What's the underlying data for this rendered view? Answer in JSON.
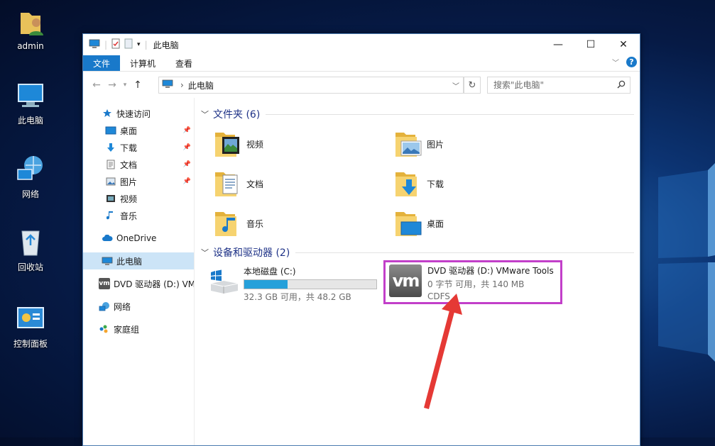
{
  "desktop": {
    "icons": [
      {
        "label": "admin",
        "icon": "user-folder-icon"
      },
      {
        "label": "此电脑",
        "icon": "computer-icon"
      },
      {
        "label": "网络",
        "icon": "network-icon"
      },
      {
        "label": "回收站",
        "icon": "recycle-bin-icon"
      },
      {
        "label": "控制面板",
        "icon": "control-panel-icon"
      }
    ]
  },
  "window": {
    "title": "此电脑",
    "controls": {
      "minimize": "—",
      "maximize": "☐",
      "close": "✕"
    }
  },
  "ribbon": {
    "tabs": [
      "文件",
      "计算机",
      "查看"
    ],
    "help": "?"
  },
  "address": {
    "path": "此电脑",
    "search_placeholder": "搜索\"此电脑\""
  },
  "navpane": {
    "quick_access": "快速访问",
    "quick_items": [
      {
        "label": "桌面",
        "icon": "desktop-icon",
        "pinned": true
      },
      {
        "label": "下载",
        "icon": "download-icon",
        "pinned": true
      },
      {
        "label": "文档",
        "icon": "document-icon",
        "pinned": true
      },
      {
        "label": "图片",
        "icon": "picture-icon",
        "pinned": true
      },
      {
        "label": "视频",
        "icon": "video-icon",
        "pinned": false
      },
      {
        "label": "音乐",
        "icon": "music-icon",
        "pinned": false
      }
    ],
    "onedrive": "OneDrive",
    "this_pc": "此电脑",
    "dvd": "DVD 驱动器 (D:) VMware Tools",
    "network": "网络",
    "homegroup": "家庭组"
  },
  "folders_group": {
    "title": "文件夹 (6)",
    "items": [
      {
        "label": "视频",
        "icon": "video-folder-icon"
      },
      {
        "label": "图片",
        "icon": "pictures-folder-icon"
      },
      {
        "label": "文档",
        "icon": "documents-folder-icon"
      },
      {
        "label": "下载",
        "icon": "downloads-folder-icon"
      },
      {
        "label": "音乐",
        "icon": "music-folder-icon"
      },
      {
        "label": "桌面",
        "icon": "desktop-folder-icon"
      }
    ]
  },
  "devices_group": {
    "title": "设备和驱动器 (2)",
    "local_disk": {
      "name": "本地磁盘 (C:)",
      "usage": "32.3 GB 可用，共 48.2 GB",
      "used_fraction": 0.33
    },
    "dvd": {
      "name": "DVD 驱动器 (D:) VMware Tools",
      "usage": "0 字节 可用，共 140 MB",
      "fs": "CDFS",
      "logo": "vm"
    }
  },
  "colors": {
    "accent": "#1979ca",
    "highlight_box": "#c23fc9",
    "arrow": "#e53935",
    "selection": "#cce4f7"
  }
}
